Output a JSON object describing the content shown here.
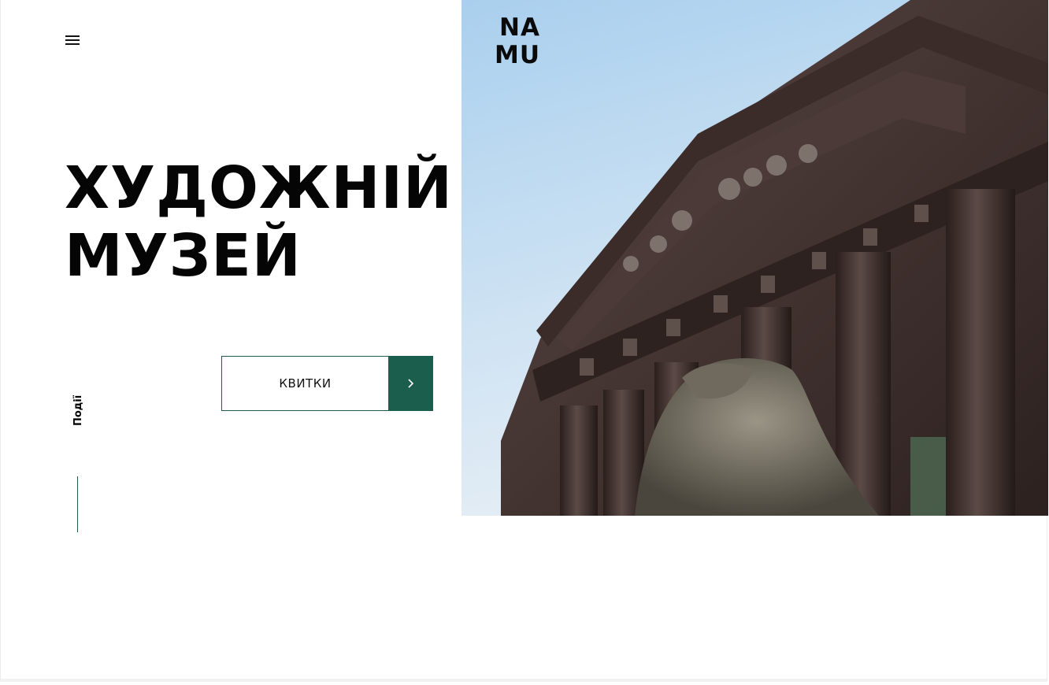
{
  "header": {
    "logo_line1": "NA",
    "logo_line2": "MU"
  },
  "hero": {
    "title_line1": "ХУДОЖНІЙ",
    "title_line2": "МУЗЕЙ"
  },
  "actions": {
    "tickets_label": "КВИТКИ"
  },
  "side_nav": {
    "events_label": "Події"
  },
  "colors": {
    "accent": "#1b5e4d",
    "sky": "#c9e1f2",
    "stone": "#3d2e2b"
  },
  "icons": {
    "menu": "hamburger-icon",
    "arrow": "chevron-right-icon"
  }
}
